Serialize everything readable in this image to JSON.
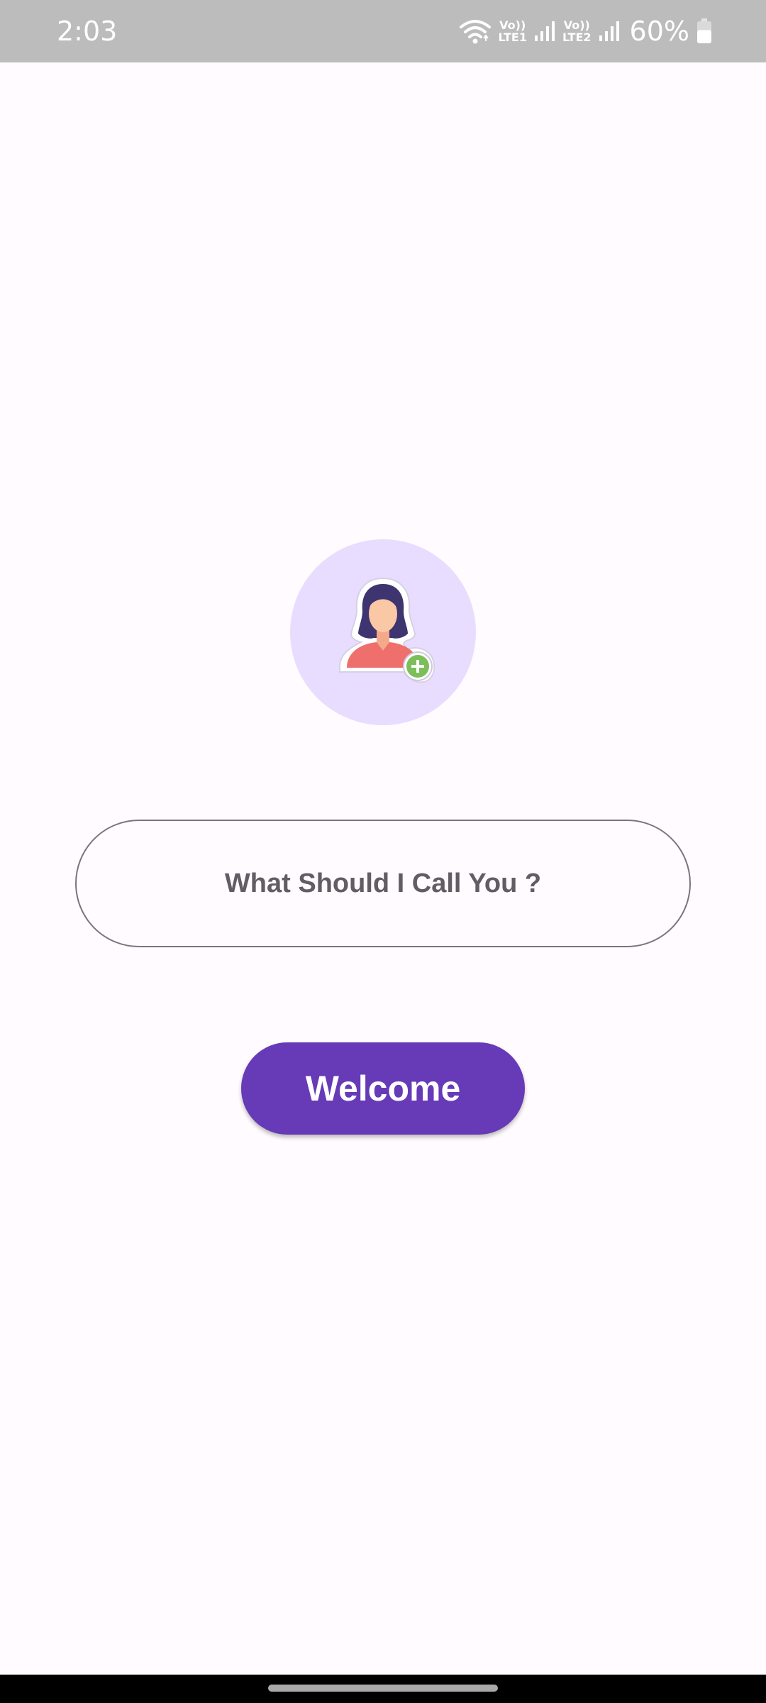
{
  "status_bar": {
    "time": "2:03",
    "sim1_top": "Vo))",
    "sim1_bottom": "LTE1",
    "sim2_top": "Vo))",
    "sim2_bottom": "LTE2",
    "battery": "60%",
    "battery_level": 0.6,
    "icons": [
      "wifi-icon",
      "signal-icon",
      "signal-icon",
      "battery-icon"
    ]
  },
  "profile": {
    "icon": "add-user-icon"
  },
  "name_input": {
    "placeholder": "What Should I Call You ?",
    "value": ""
  },
  "welcome_button": {
    "label": "Welcome"
  },
  "colors": {
    "accent": "#673ab7",
    "avatar_bg": "#e8ddff",
    "plus_green": "#7cbf5a",
    "status_bar_bg": "#bdbcbd",
    "page_bg": "#fffbfe"
  }
}
